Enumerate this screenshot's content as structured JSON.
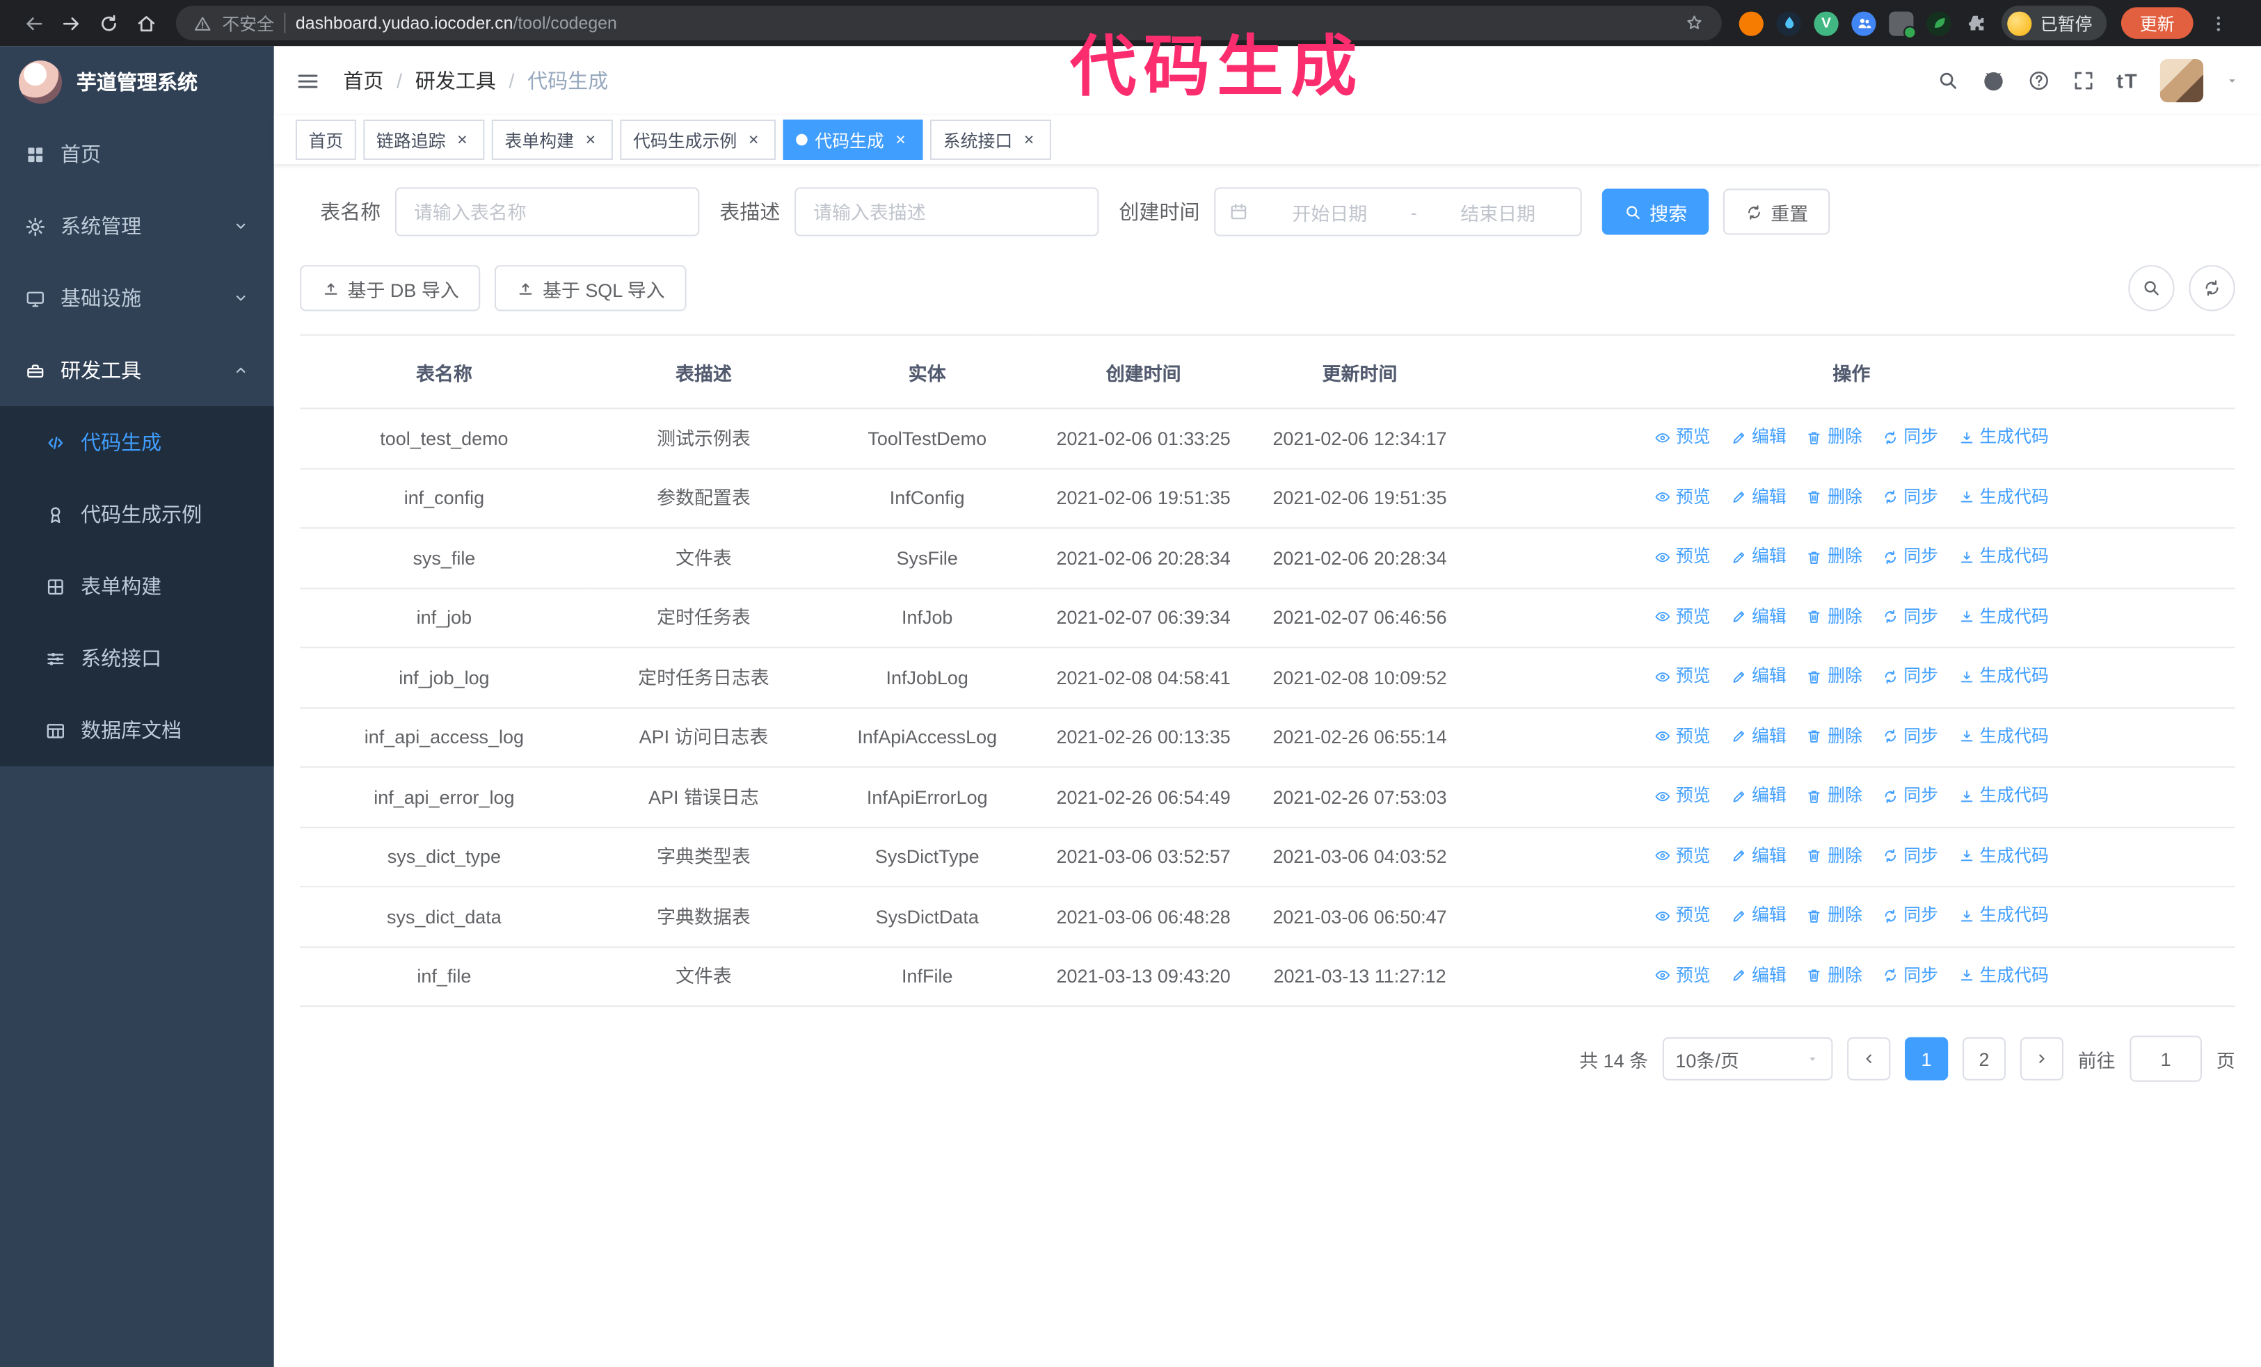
{
  "colors": {
    "accent": "#409eff",
    "annotation": "#fb2d6f",
    "sidebar_bg": "#304156",
    "submenu_bg": "#1f2d3d",
    "update_button_bg": "#e2603f"
  },
  "browser": {
    "warning_label": "不安全",
    "url_domain": "dashboard.yudao.iocoder.cn",
    "url_path": "/tool/codegen",
    "paused_label": "已暂停",
    "update_label": "更新"
  },
  "annotation": {
    "text": "代码生成"
  },
  "sidebar": {
    "title": "芋道管理系统",
    "items": [
      {
        "label": "首页"
      },
      {
        "label": "系统管理"
      },
      {
        "label": "基础设施"
      },
      {
        "label": "研发工具"
      }
    ],
    "subitems": [
      {
        "label": "代码生成"
      },
      {
        "label": "代码生成示例"
      },
      {
        "label": "表单构建"
      },
      {
        "label": "系统接口"
      },
      {
        "label": "数据库文档"
      }
    ]
  },
  "header": {
    "breadcrumb": [
      "首页",
      "研发工具",
      "代码生成"
    ],
    "font_size_icon_label": "tT"
  },
  "tabs": [
    {
      "label": "首页"
    },
    {
      "label": "链路追踪"
    },
    {
      "label": "表单构建"
    },
    {
      "label": "代码生成示例"
    },
    {
      "label": "代码生成"
    },
    {
      "label": "系统接口"
    }
  ],
  "filters": {
    "table_name_label": "表名称",
    "table_name_placeholder": "请输入表名称",
    "table_desc_label": "表描述",
    "table_desc_placeholder": "请输入表描述",
    "create_time_label": "创建时间",
    "date_start_placeholder": "开始日期",
    "date_separator": "-",
    "date_end_placeholder": "结束日期",
    "search_label": "搜索",
    "reset_label": "重置"
  },
  "toolbar": {
    "import_db_label": "基于 DB 导入",
    "import_sql_label": "基于 SQL 导入"
  },
  "table": {
    "columns": [
      "表名称",
      "表描述",
      "实体",
      "创建时间",
      "更新时间",
      "操作"
    ],
    "actions": [
      "预览",
      "编辑",
      "删除",
      "同步",
      "生成代码"
    ],
    "rows": [
      {
        "name": "tool_test_demo",
        "desc": "测试示例表",
        "entity": "ToolTestDemo",
        "created": "2021-02-06 01:33:25",
        "updated": "2021-02-06 12:34:17"
      },
      {
        "name": "inf_config",
        "desc": "参数配置表",
        "entity": "InfConfig",
        "created": "2021-02-06 19:51:35",
        "updated": "2021-02-06 19:51:35"
      },
      {
        "name": "sys_file",
        "desc": "文件表",
        "entity": "SysFile",
        "created": "2021-02-06 20:28:34",
        "updated": "2021-02-06 20:28:34"
      },
      {
        "name": "inf_job",
        "desc": "定时任务表",
        "entity": "InfJob",
        "created": "2021-02-07 06:39:34",
        "updated": "2021-02-07 06:46:56"
      },
      {
        "name": "inf_job_log",
        "desc": "定时任务日志表",
        "entity": "InfJobLog",
        "created": "2021-02-08 04:58:41",
        "updated": "2021-02-08 10:09:52"
      },
      {
        "name": "inf_api_access_log",
        "desc": "API 访问日志表",
        "entity": "InfApiAccessLog",
        "created": "2021-02-26 00:13:35",
        "updated": "2021-02-26 06:55:14"
      },
      {
        "name": "inf_api_error_log",
        "desc": "API 错误日志",
        "entity": "InfApiErrorLog",
        "created": "2021-02-26 06:54:49",
        "updated": "2021-02-26 07:53:03"
      },
      {
        "name": "sys_dict_type",
        "desc": "字典类型表",
        "entity": "SysDictType",
        "created": "2021-03-06 03:52:57",
        "updated": "2021-03-06 04:03:52"
      },
      {
        "name": "sys_dict_data",
        "desc": "字典数据表",
        "entity": "SysDictData",
        "created": "2021-03-06 06:48:28",
        "updated": "2021-03-06 06:50:47"
      },
      {
        "name": "inf_file",
        "desc": "文件表",
        "entity": "InfFile",
        "created": "2021-03-13 09:43:20",
        "updated": "2021-03-13 11:27:12"
      }
    ]
  },
  "pagination": {
    "total_label": "共 14 条",
    "page_size_label": "10条/页",
    "pages": [
      "1",
      "2"
    ],
    "goto_prefix": "前往",
    "goto_value": "1",
    "goto_suffix": "页"
  }
}
